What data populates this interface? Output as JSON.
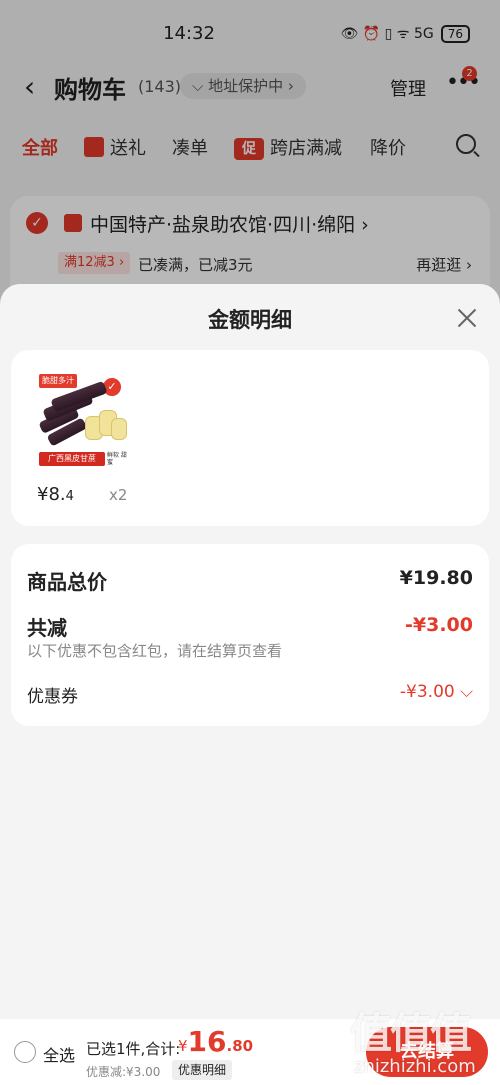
{
  "status": {
    "time": "14:32",
    "icons": "👁 ⏰ ▯ ᯤ 5G",
    "battery": "76"
  },
  "nav": {
    "title": "购物车",
    "count": "(143)",
    "address": "⌵ 地址保护中 ›",
    "manage": "管理",
    "more_badge": "2"
  },
  "tabs": [
    {
      "label": "全部"
    },
    {
      "label": "送礼"
    },
    {
      "label": "凑单"
    },
    {
      "label": "跨店满减",
      "icon_text": "促"
    },
    {
      "label": "降价"
    }
  ],
  "store": {
    "name": "中国特产·盐泉助农馆·四川·绵阳 ›",
    "promo_tag": "满12减3 ›",
    "promo_text": "已凑满，已减3元",
    "browse_more": "再逛逛 ›"
  },
  "sheet": {
    "title": "金额明细",
    "product": {
      "image_top_tag": "脆甜多汁",
      "image_banner": "广西黑皮甘蔗",
      "image_side": "鲜软 甜蜜",
      "price_main": "¥8.",
      "price_small": "4",
      "quantity": "x2"
    },
    "summary": {
      "total_label": "商品总价",
      "total_value": "¥19.80",
      "reduce_label": "共减",
      "reduce_value": "-¥3.00",
      "note": "以下优惠不包含红包，请在结算页查看",
      "coupon_label": "优惠券",
      "coupon_value": "-¥3.00 ⌵"
    }
  },
  "bottom": {
    "select_all": "全选",
    "selected_info": "已选1件,合计:",
    "total_yen": "¥",
    "total_big": "16",
    "total_dec": ".80",
    "discount": "优惠减:¥3.00",
    "detail": "优惠明细",
    "checkout": "去结算"
  },
  "watermark": {
    "big": "值值值",
    "small": "zhizhizhi.com"
  },
  "colors": {
    "accent": "#e23a2b",
    "background": "#f4f4f4",
    "card": "#ffffff"
  }
}
